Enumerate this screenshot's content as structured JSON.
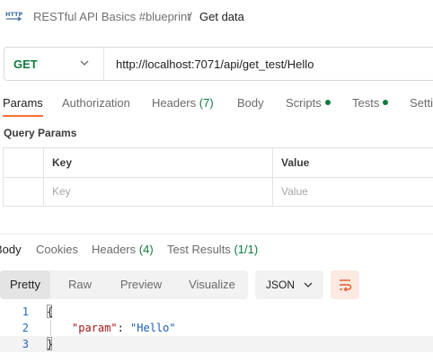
{
  "breadcrumb": {
    "icon": "http-request-icon",
    "collection": "RESTful API Basics #blueprint",
    "separator": "/",
    "current": "Get data"
  },
  "request": {
    "method": "GET",
    "url": "http://localhost:7071/api/get_test/Hello"
  },
  "tabs": {
    "params": "Params",
    "authorization": "Authorization",
    "headers_label": "Headers",
    "headers_count": "(7)",
    "body": "Body",
    "scripts": "Scripts",
    "tests": "Tests",
    "settings": "Setti"
  },
  "query_params": {
    "title": "Query Params",
    "key_header": "Key",
    "value_header": "Value",
    "key_placeholder": "Key",
    "value_placeholder": "Value"
  },
  "response_tabs": {
    "body": "Body",
    "cookies": "Cookies",
    "headers_label": "Headers",
    "headers_count": "(4)",
    "test_results_label": "Test Results",
    "test_results_count": "(1/1)"
  },
  "view": {
    "pretty": "Pretty",
    "raw": "Raw",
    "preview": "Preview",
    "visualize": "Visualize",
    "format": "JSON"
  },
  "code": {
    "line1_num": "1",
    "line2_num": "2",
    "line3_num": "3",
    "line1": "{",
    "line2_key": "\"param\"",
    "line2_colon": ": ",
    "line2_value": "\"Hello\"",
    "line3": "}"
  },
  "colors": {
    "accent": "#ff6c37",
    "method_get": "#0f7b3e",
    "status_dot": "#0f7b3e"
  }
}
